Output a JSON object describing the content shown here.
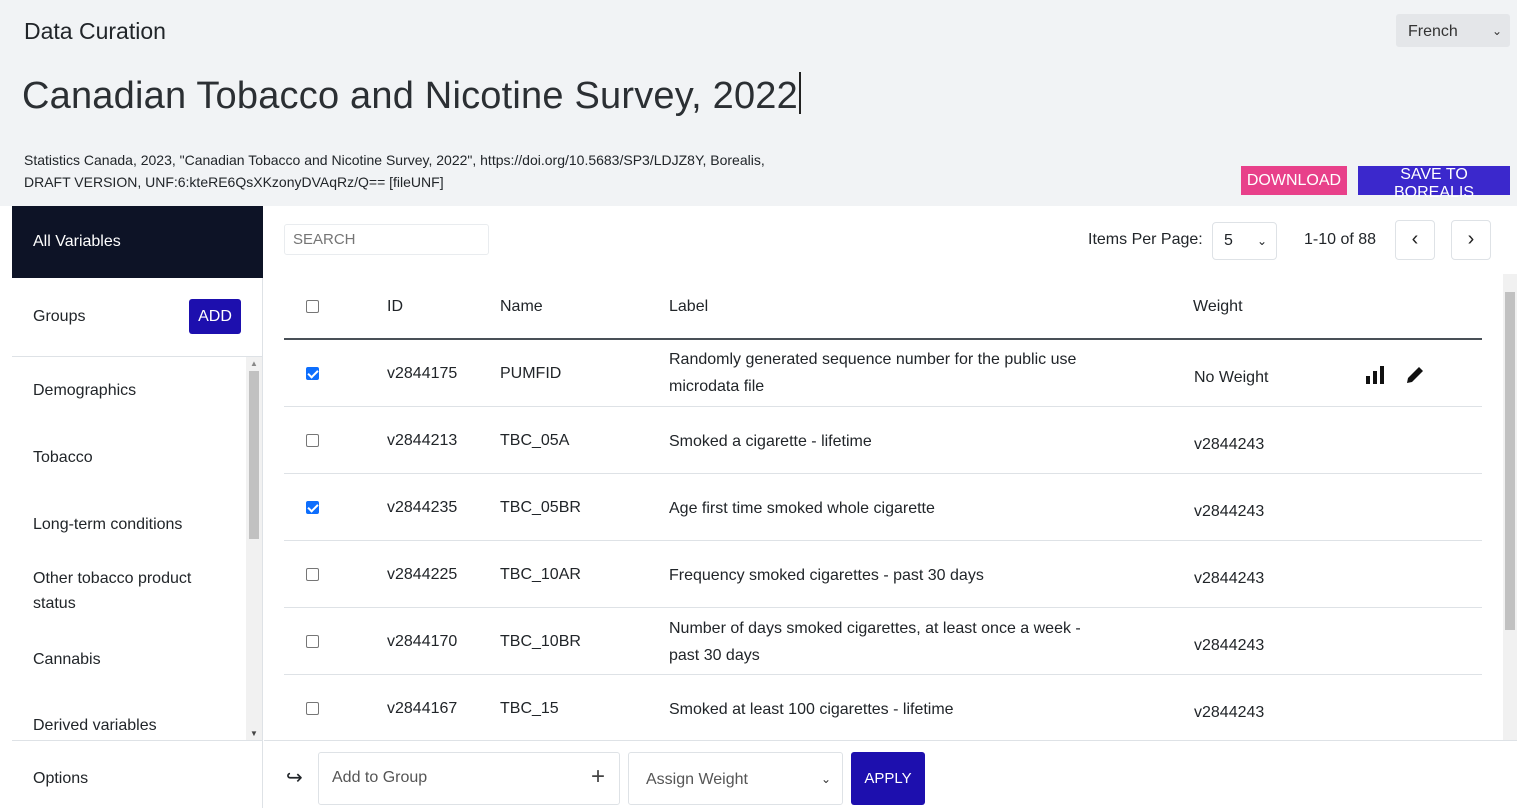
{
  "header": {
    "app_title": "Data Curation",
    "language": "French",
    "dataset_title": "Canadian Tobacco and Nicotine Survey, 2022",
    "citation_line1": "Statistics Canada, 2023, \"Canadian Tobacco and Nicotine Survey, 2022\", https://doi.org/10.5683/SP3/LDJZ8Y, Borealis,",
    "citation_line2": "DRAFT VERSION, UNF:6:kteRE6QsXKzonyDVAqRz/Q== [fileUNF]",
    "download_label": "DOWNLOAD",
    "save_label": "SAVE TO BOREALIS",
    "colors": {
      "download": "#e8408a",
      "save": "#3b28cc"
    }
  },
  "sidebar": {
    "all_variables": "All Variables",
    "groups_label": "Groups",
    "add_label": "ADD",
    "groups": [
      "Demographics",
      "Tobacco",
      "Long-term conditions",
      "Other tobacco product status",
      "Cannabis",
      "Derived variables"
    ],
    "options_label": "Options"
  },
  "toolbar": {
    "search_placeholder": "SEARCH",
    "items_per_page_label": "Items Per Page:",
    "items_per_page_value": "5",
    "range_text": "1-10 of 88",
    "prev_icon": "chevron-left",
    "next_icon": "chevron-right"
  },
  "table": {
    "headers": {
      "id": "ID",
      "name": "Name",
      "label": "Label",
      "weight": "Weight"
    },
    "rows": [
      {
        "checked": true,
        "id": "v2844175",
        "name": "PUMFID",
        "label": "Randomly generated sequence number for the public use microdata file",
        "weight": "No Weight"
      },
      {
        "checked": false,
        "id": "v2844213",
        "name": "TBC_05A",
        "label": "Smoked a cigarette - lifetime",
        "weight": "v2844243"
      },
      {
        "checked": true,
        "id": "v2844235",
        "name": "TBC_05BR",
        "label": "Age first time smoked whole cigarette",
        "weight": "v2844243"
      },
      {
        "checked": false,
        "id": "v2844225",
        "name": "TBC_10AR",
        "label": "Frequency smoked cigarettes - past 30 days",
        "weight": "v2844243"
      },
      {
        "checked": false,
        "id": "v2844170",
        "name": "TBC_10BR",
        "label": "Number of days smoked cigarettes, at least once a week - past 30 days",
        "weight": "v2844243"
      },
      {
        "checked": false,
        "id": "v2844167",
        "name": "TBC_15",
        "label": "Smoked at least 100 cigarettes - lifetime",
        "weight": "v2844243"
      }
    ]
  },
  "bottom": {
    "add_to_group": "Add to Group",
    "assign_weight": "Assign Weight",
    "apply_label": "APPLY"
  }
}
